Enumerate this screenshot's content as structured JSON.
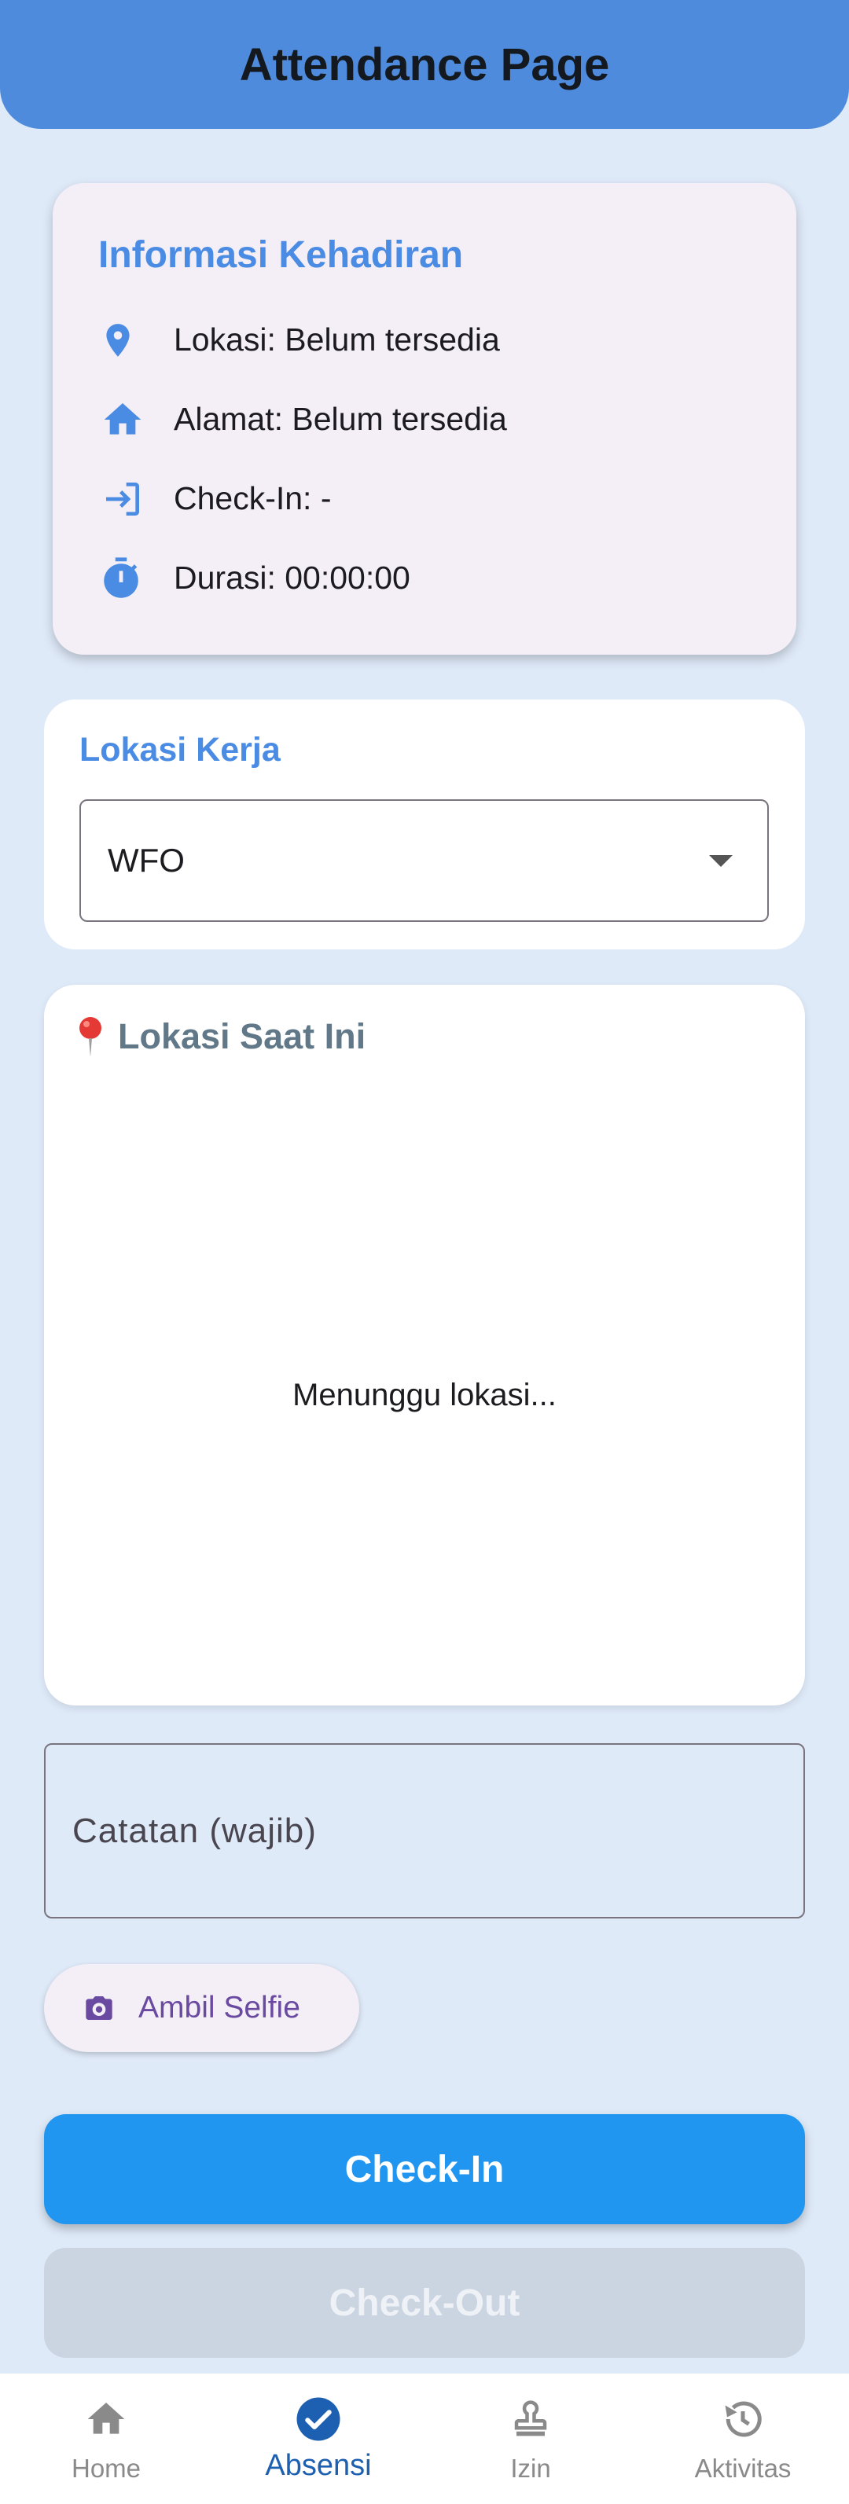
{
  "appbar": {
    "title": "Attendance Page"
  },
  "info": {
    "title": "Informasi Kehadiran",
    "rows": [
      {
        "icon": "location-pin-icon",
        "text": "Lokasi: Belum tersedia"
      },
      {
        "icon": "home-icon",
        "text": "Alamat: Belum tersedia"
      },
      {
        "icon": "login-icon",
        "text": "Check-In: -"
      },
      {
        "icon": "timer-icon",
        "text": "Durasi: 00:00:00"
      }
    ]
  },
  "work_location": {
    "title": "Lokasi Kerja",
    "selected": "WFO"
  },
  "current_location": {
    "pin_emoji": "📍",
    "title": "Lokasi Saat Ini",
    "status": "Menunggu lokasi..."
  },
  "notes": {
    "placeholder": "Catatan (wajib)"
  },
  "selfie": {
    "label": "Ambil Selfie"
  },
  "actions": {
    "checkin": "Check-In",
    "checkout": "Check-Out"
  },
  "nav": {
    "items": [
      {
        "label": "Home",
        "icon": "home-icon"
      },
      {
        "label": "Absensi",
        "icon": "check-circle-icon"
      },
      {
        "label": "Izin",
        "icon": "stamp-icon"
      },
      {
        "label": "Aktivitas",
        "icon": "history-icon"
      }
    ]
  },
  "colors": {
    "appbar": "#4f8bdc",
    "accent": "#4a8be4",
    "primary_button": "#2196f0",
    "disabled_button": "#cbd5e1",
    "background": "#dfeaf9"
  }
}
